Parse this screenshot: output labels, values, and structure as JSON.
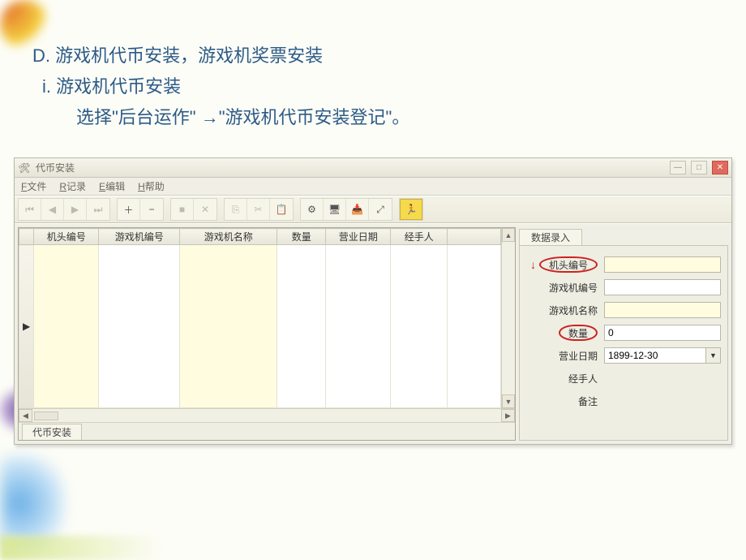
{
  "heading": {
    "line1": "D. 游戏机代币安装，游戏机奖票安装",
    "line2": "i. 游戏机代币安装",
    "line3": "选择\"后台运作\" →\"游戏机代币安装登记\"。"
  },
  "window": {
    "title": "代币安装",
    "menus": [
      "F文件",
      "R记录",
      "E编辑",
      "H帮助"
    ],
    "toolbar_icons": {
      "first": "⏮",
      "prev": "◀",
      "next": "▶",
      "last": "⏭",
      "add": "＋",
      "delete": "−",
      "stop": "■",
      "cancel": "✕",
      "copy": "⎘",
      "cut": "✂",
      "paste": "📋",
      "tool1": "⚙",
      "tool2": "🖥",
      "tool3": "📥",
      "tool4": "⤢",
      "run": "🏃"
    },
    "win_btns": {
      "min": "—",
      "max": "□",
      "close": "✕"
    },
    "grid": {
      "columns": [
        "机头编号",
        "游戏机编号",
        "游戏机名称",
        "数量",
        "营业日期",
        "经手人"
      ],
      "indicator": "▶",
      "tab": "代币安装"
    },
    "panel": {
      "tab": "数据录入",
      "fields": {
        "head_no": {
          "label": "机头编号",
          "value": ""
        },
        "machine_no": {
          "label": "游戏机编号",
          "value": ""
        },
        "machine_name": {
          "label": "游戏机名称",
          "value": ""
        },
        "qty": {
          "label": "数量",
          "value": "0"
        },
        "biz_date": {
          "label": "营业日期",
          "value": "1899-12-30"
        },
        "operator": {
          "label": "经手人",
          "value": ""
        },
        "remark": {
          "label": "备注",
          "value": ""
        }
      }
    }
  }
}
